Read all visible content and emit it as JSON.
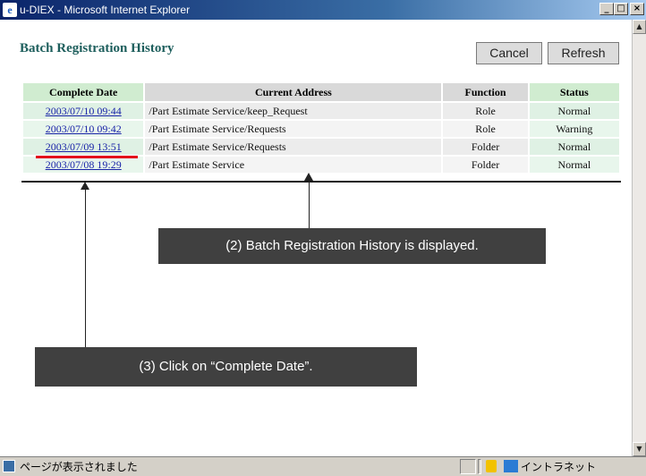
{
  "window": {
    "title": "u-DIEX - Microsoft Internet Explorer",
    "icon": "ie-icon",
    "controls": {
      "minimize": "_",
      "maximize": "□",
      "close": "×"
    }
  },
  "page": {
    "title": "Batch Registration History",
    "buttons": {
      "cancel": "Cancel",
      "refresh": "Refresh"
    }
  },
  "table": {
    "columns": [
      "Complete Date",
      "Current Address",
      "Function",
      "Status"
    ],
    "rows": [
      {
        "date": "2003/07/10 09:44",
        "address": "/Part Estimate Service/keep_Request",
        "function": "Role",
        "status": "Normal"
      },
      {
        "date": "2003/07/10 09:42",
        "address": "/Part Estimate Service/Requests",
        "function": "Role",
        "status": "Warning"
      },
      {
        "date": "2003/07/09 13:51",
        "address": "/Part Estimate Service/Requests",
        "function": "Folder",
        "status": "Normal"
      },
      {
        "date": "2003/07/08 19:29",
        "address": "/Part Estimate Service",
        "function": "Folder",
        "status": "Normal"
      }
    ]
  },
  "callouts": {
    "history_displayed": "(2) Batch Registration History is displayed.",
    "click_date": "(3) Click on “Complete Date”."
  },
  "status_bar": {
    "message": "ページが表示されました",
    "zone": "イントラネット"
  },
  "colors": {
    "title_green": "#1d5e5c",
    "link_blue": "#1a24a8",
    "highlight_red": "#e3001b",
    "callout_bg": "#404040"
  }
}
